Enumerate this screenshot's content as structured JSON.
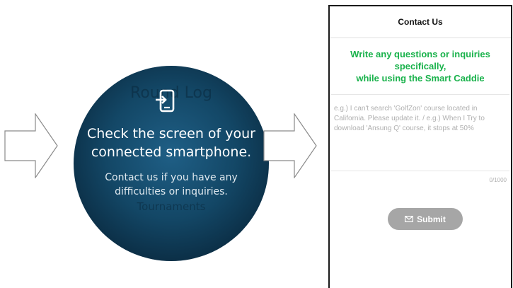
{
  "watch": {
    "background_text_top": "Round Log",
    "background_text_bottom": "Tournaments",
    "icon": "phone-connect-icon",
    "title_line1": "Check the screen of your",
    "title_line2": "connected smartphone.",
    "sub_line1": "Contact us if you have any",
    "sub_line2": "difficulties or inquiries."
  },
  "phone": {
    "header_title": "Contact Us",
    "headline_line1": "Write any questions or inquiries",
    "headline_line2": "specifically,",
    "headline_line3": "while using the Smart Caddie",
    "placeholder": "e.g.) I can't search 'GolfZon' course located in California. Please update it. / e.g.) When I Try to download 'Ansung Q' course, it stops at 50%",
    "counter": "0/1000",
    "submit_label": "Submit",
    "submit_icon": "mail-icon"
  },
  "colors": {
    "headline": "#19b24b",
    "submit_bg": "#a6a6a6",
    "watch_bg": "#134766"
  }
}
